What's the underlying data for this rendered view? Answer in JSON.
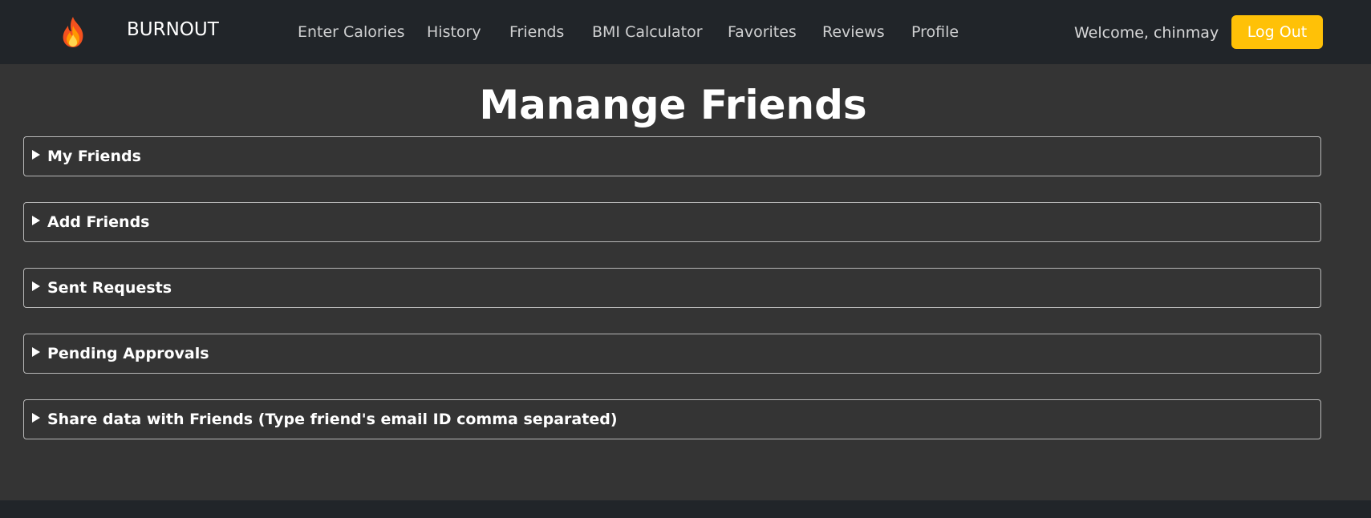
{
  "header": {
    "brand_icon": "flame-icon",
    "brand_name": "BURNOUT",
    "nav_items": [
      {
        "label": "Enter Calories"
      },
      {
        "label": "History"
      },
      {
        "label": "Friends"
      },
      {
        "label": "BMI Calculator"
      },
      {
        "label": "Favorites"
      },
      {
        "label": "Reviews"
      },
      {
        "label": "Profile"
      }
    ],
    "welcome_text": "Welcome, chinmay",
    "logout_label": "Log Out"
  },
  "main": {
    "title": "Manange Friends",
    "sections": [
      {
        "label": "My Friends"
      },
      {
        "label": "Add Friends"
      },
      {
        "label": "Sent Requests"
      },
      {
        "label": "Pending Approvals"
      },
      {
        "label": "Share data with Friends (Type friend's email ID comma separated)"
      }
    ]
  },
  "colors": {
    "navbar_bg": "#212529",
    "content_bg": "#343434",
    "accent": "#ffc107",
    "text": "#ffffff"
  }
}
